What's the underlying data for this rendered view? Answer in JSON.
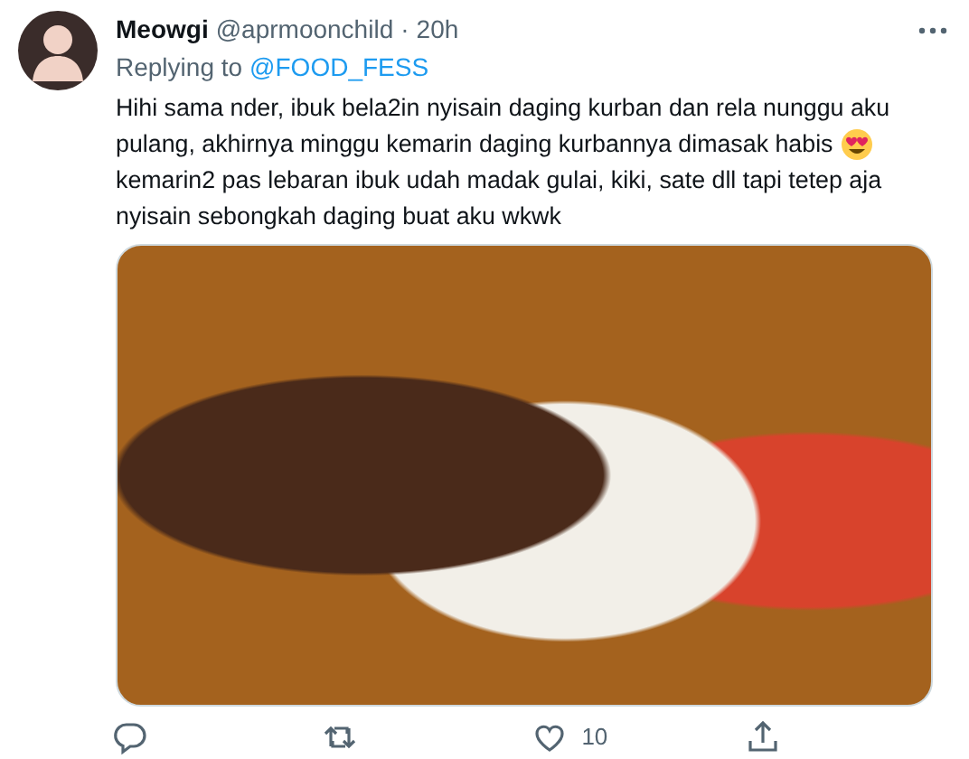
{
  "tweet": {
    "display_name": "Meowgi",
    "handle": "@aprmoonchild",
    "separator": "·",
    "time": "20h",
    "replying_label": "Replying to",
    "replying_to": "@FOOD_FESS",
    "text_lines": [
      {
        "text": "Hihi sama nder, ibuk bela2in nyisain daging kurban dan rela nunggu aku",
        "emoji": false
      },
      {
        "text": "pulang, akhirnya minggu kemarin daging kurbannya dimasak habis",
        "emoji": true
      },
      {
        "text": "kemarin2 pas lebaran ibuk udah madak gulai, kiki, sate dll tapi tetep aja",
        "emoji": false
      },
      {
        "text": "nyisain sebongkah daging buat aku wkwk",
        "emoji": false
      }
    ],
    "actions": [
      {
        "kind": "reply"
      },
      {
        "kind": "retweet"
      },
      {
        "kind": "like",
        "count": "10"
      },
      {
        "kind": "share"
      }
    ]
  }
}
